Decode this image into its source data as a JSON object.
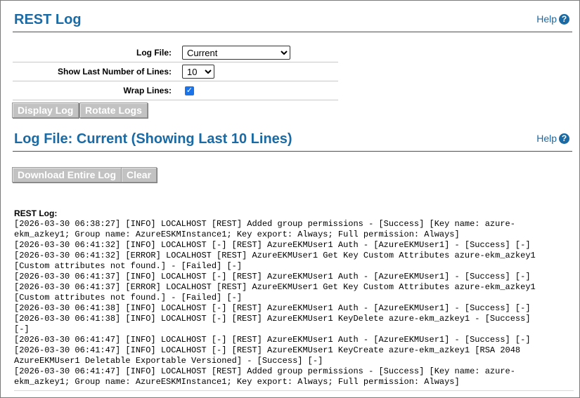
{
  "rest_log_section": {
    "title": "REST Log",
    "help_label": "Help"
  },
  "form": {
    "log_file_label": "Log File:",
    "log_file_value": "Current",
    "show_lines_label": "Show Last Number of Lines:",
    "show_lines_value": "10",
    "wrap_lines_label": "Wrap Lines:",
    "wrap_lines_checked": true
  },
  "buttons": {
    "display_log": "Display Log",
    "rotate_logs": "Rotate Logs",
    "download_entire_log": "Download Entire Log",
    "clear": "Clear"
  },
  "log_file_section": {
    "title": "Log File: Current (Showing Last 10 Lines)",
    "help_label": "Help"
  },
  "log": {
    "label": "REST Log:",
    "lines": [
      "[2026-03-30 06:38:27] [INFO] LOCALHOST [REST] Added group permissions - [Success] [Key name: azure-",
      "ekm_azkey1; Group name: AzureESKMInstance1; Key export: Always; Full permission: Always]",
      "[2026-03-30 06:41:32] [INFO] LOCALHOST [-] [REST] AzureEKMUser1 Auth - [AzureEKMUser1] - [Success] [-]",
      "[2026-03-30 06:41:32] [ERROR] LOCALHOST [REST] AzureEKMUser1 Get Key Custom Attributes azure-ekm_azkey1",
      "[Custom attributes not found.] - [Failed] [-]",
      "[2026-03-30 06:41:37] [INFO] LOCALHOST [-] [REST] AzureEKMUser1 Auth - [AzureEKMUser1] - [Success] [-]",
      "[2026-03-30 06:41:37] [ERROR] LOCALHOST [REST] AzureEKMUser1 Get Key Custom Attributes azure-ekm_azkey1",
      "[Custom attributes not found.] - [Failed] [-]",
      "[2026-03-30 06:41:38] [INFO] LOCALHOST [-] [REST] AzureEKMUser1 Auth - [AzureEKMUser1] - [Success] [-]",
      "[2026-03-30 06:41:38] [INFO] LOCALHOST [-] [REST] AzureEKMUser1 KeyDelete azure-ekm_azkey1 - [Success]",
      "[-]",
      "[2026-03-30 06:41:47] [INFO] LOCALHOST [-] [REST] AzureEKMUser1 Auth - [AzureEKMUser1] - [Success] [-]",
      "[2026-03-30 06:41:47] [INFO] LOCALHOST [-] [REST] AzureEKMUser1 KeyCreate azure-ekm_azkey1 [RSA 2048",
      "AzureEKMUser1 Deletable Exportable Versioned] - [Success] [-]",
      "[2026-03-30 06:41:47] [INFO] LOCALHOST [REST] Added group permissions - [Success] [Key name: azure-",
      "ekm_azkey1; Group name: AzureESKMInstance1; Key export: Always; Full permission: Always]"
    ]
  },
  "colors": {
    "accent": "#1a6aa5",
    "button_bg": "#c2c2c2",
    "checkbox": "#1a73e8"
  },
  "icons": {
    "help": "question-circle-icon",
    "checkbox": "checkmark-icon"
  }
}
